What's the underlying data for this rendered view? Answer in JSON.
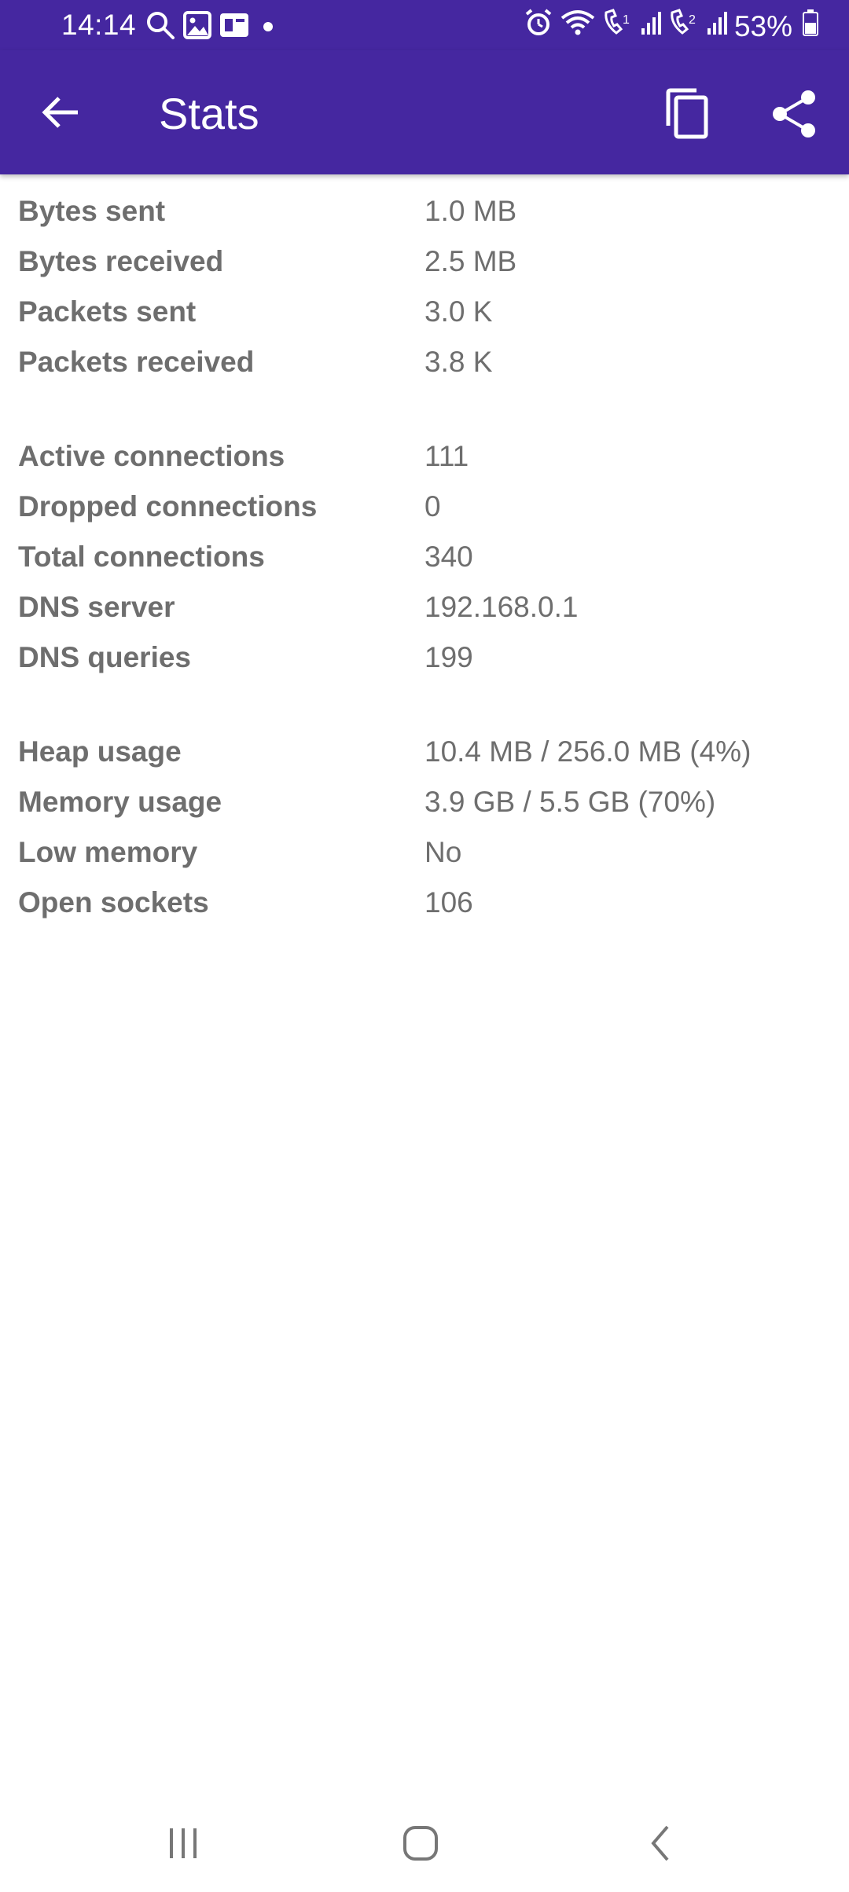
{
  "status_bar": {
    "time": "14:14",
    "battery": "53%",
    "left_icons": [
      "search-icon",
      "image-icon",
      "news-icon",
      "dot-icon"
    ],
    "right_icons": [
      "alarm-icon",
      "wifi-icon",
      "sim1-icon",
      "signal-icon",
      "sim2-icon",
      "signal-icon",
      "battery-icon"
    ]
  },
  "app_bar": {
    "title": "Stats",
    "back_icon": "arrow-back-icon",
    "copy_icon": "copy-icon",
    "share_icon": "share-icon",
    "background": "#4527a0"
  },
  "stats": {
    "groups": [
      {
        "rows": [
          {
            "label": "Bytes sent",
            "value": "1.0 MB"
          },
          {
            "label": "Bytes received",
            "value": "2.5 MB"
          },
          {
            "label": "Packets sent",
            "value": "3.0 K"
          },
          {
            "label": "Packets received",
            "value": "3.8 K"
          }
        ]
      },
      {
        "rows": [
          {
            "label": "Active connections",
            "value": "111"
          },
          {
            "label": "Dropped connections",
            "value": "0"
          },
          {
            "label": "Total connections",
            "value": "340"
          },
          {
            "label": "DNS server",
            "value": "192.168.0.1"
          },
          {
            "label": "DNS queries",
            "value": "199"
          }
        ]
      },
      {
        "rows": [
          {
            "label": "Heap usage",
            "value": "10.4 MB / 256.0 MB (4%)"
          },
          {
            "label": "Memory usage",
            "value": "3.9 GB / 5.5 GB (70%)"
          },
          {
            "label": "Low memory",
            "value": "No"
          },
          {
            "label": "Open sockets",
            "value": "106"
          }
        ]
      }
    ]
  },
  "nav_bar": {
    "recents_icon": "recents-icon",
    "home_icon": "home-icon",
    "back_icon": "nav-back-icon"
  }
}
